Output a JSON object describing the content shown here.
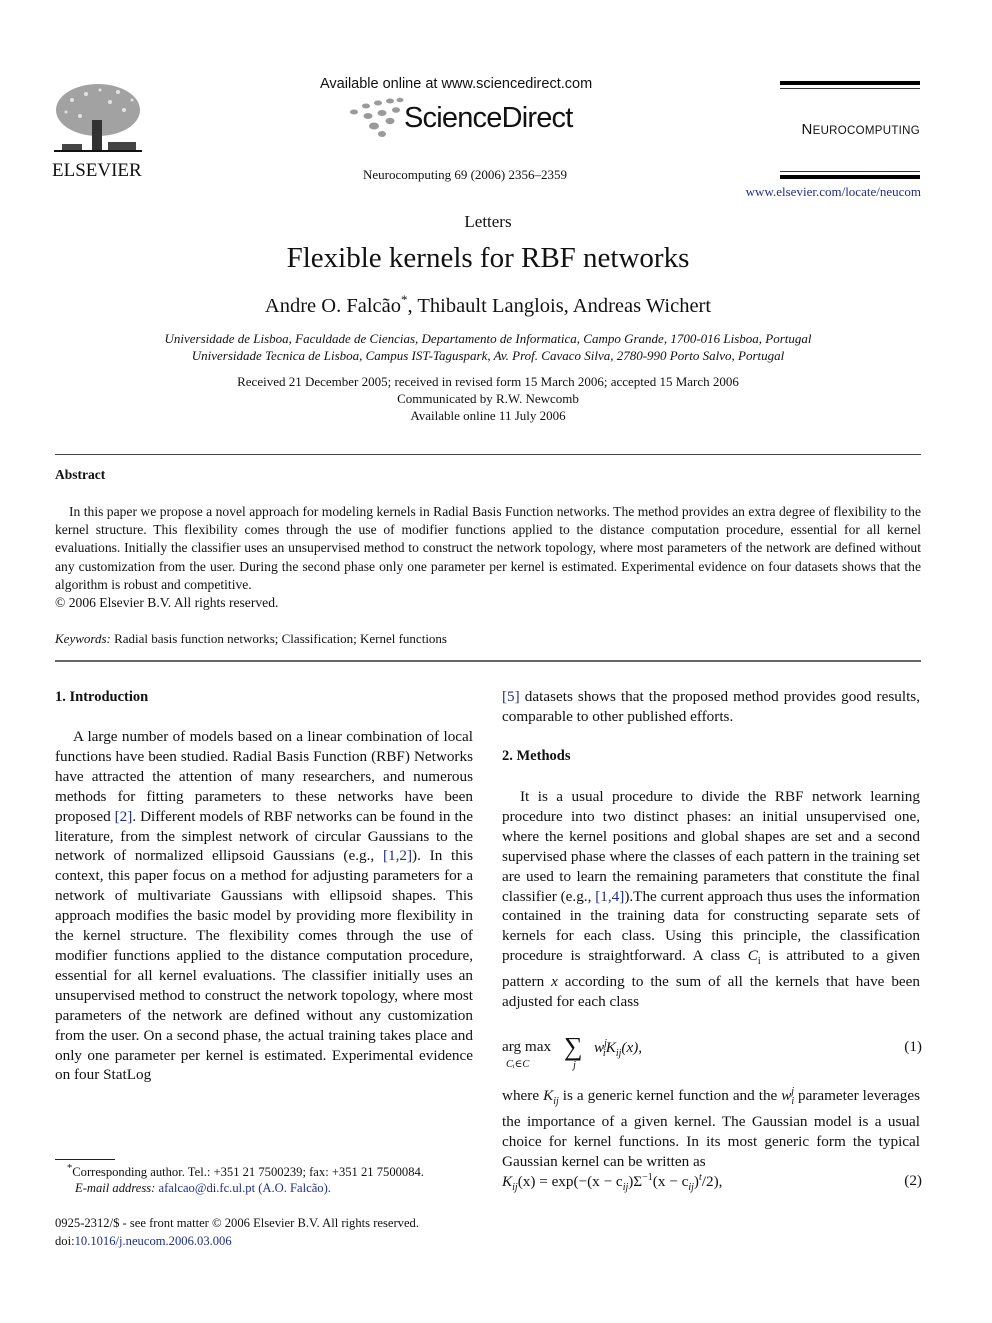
{
  "header": {
    "publisher": "ELSEVIER",
    "available_online": "Available online at www.sciencedirect.com",
    "sciencedirect_logo": "ScienceDirect",
    "journal_reference": "Neurocomputing 69 (2006) 2356–2359",
    "journal_name_first": "N",
    "journal_name_rest": "EUROCOMPUTING",
    "journal_url": "www.elsevier.com/locate/neucom"
  },
  "article": {
    "section_type": "Letters",
    "title": "Flexible kernels for RBF networks",
    "authors": {
      "author1": "Andre O. Falcão",
      "author1_mark": "*",
      "rest": ", Thibault Langlois, Andreas Wichert"
    },
    "affiliations": [
      "Universidade de Lisboa, Faculdade de Ciencias, Departamento de Informatica, Campo Grande, 1700-016 Lisboa, Portugal",
      "Universidade Tecnica de Lisboa, Campus IST-Taguspark, Av. Prof. Cavaco Silva, 2780-990 Porto Salvo, Portugal"
    ],
    "dates": {
      "received": "Received 21 December 2005; received in revised form 15 March 2006; accepted 15 March 2006",
      "communicated": "Communicated by R.W. Newcomb",
      "available": "Available online 11 July 2006"
    }
  },
  "abstract": {
    "heading": "Abstract",
    "body": "In this paper we propose a novel approach for modeling kernels in Radial Basis Function networks. The method provides an extra degree of flexibility to the kernel structure. This flexibility comes through the use of modifier functions applied to the distance computation procedure, essential for all kernel evaluations. Initially the classifier uses an unsupervised method to construct the network topology, where most parameters of the network are defined without any customization from the user. During the second phase only one parameter per kernel is estimated. Experimental evidence on four datasets shows that the algorithm is robust and competitive.",
    "copyright": "© 2006 Elsevier B.V. All rights reserved.",
    "keywords_label": "Keywords:",
    "keywords": "Radial basis function networks; Classification; Kernel functions"
  },
  "sections": {
    "intro": {
      "heading": "1.  Introduction",
      "p1": "A large number of models based on a linear combination of local functions have been studied. Radial Basis Function (RBF) Networks have attracted the attention of many researchers, and numerous methods for fitting parameters to these networks have been proposed ",
      "ref_a": "[2]",
      "p2": ". Different models of RBF networks can be found in the literature, from the simplest network of circular Gaussians to the network of normalized ellipsoid Gaussians (e.g., ",
      "ref_b": "[1,2]",
      "p3": "). In this context, this paper focus on a method for adjusting parameters for a network of multivariate Gaussians with ellipsoid shapes. This approach modifies the basic model by providing more flexibility in the kernel structure. The flexibility comes through the use of modifier functions applied to the distance computation procedure, essential for all kernel evaluations. The classifier initially uses an unsupervised method to construct the network topology, where most parameters of the network are defined without any customization from the user. On a second phase, the actual training takes place and only one parameter per kernel is estimated. Experimental evidence on four StatLog"
    },
    "col2_cont": {
      "ref": "[5]",
      "text": " datasets shows that the proposed method provides good results, comparable to other published efforts."
    },
    "methods": {
      "heading": "2.  Methods",
      "p1": "It is a usual procedure to divide the RBF network learning procedure into two distinct phases: an initial unsupervised one, where the kernel positions and global shapes are set and a second supervised phase where the classes of each pattern in the training set are used to learn the remaining parameters that constitute the final classifier (e.g., ",
      "ref": "[1,4]",
      "p2": ").The current approach thus uses the information contained in the training data for constructing separate sets of kernels for each class. Using this principle, the classification procedure is straightforward. A class ",
      "ci": "C",
      "ci_sub": "i",
      "p3": " is attributed to a given pattern ",
      "x": "x",
      "p4": " according to the sum of all the kernels that have been adjusted for each class",
      "eq1": {
        "argmax": "arg max",
        "argmax_sub": "Cᵢ∈C",
        "sigma": "∑",
        "sum_sub": "j",
        "w": "w",
        "w_sup": "j",
        "w_sub": "i",
        "k": "K",
        "k_sub": "ij",
        "tail": "(x),",
        "number": "(1)"
      },
      "p5_a": "where ",
      "kij": "K",
      "kij_sub": "ij",
      "p5_b": " is a generic kernel function and the ",
      "wij": "w",
      "wij_sub": "i",
      "wij_sup": "j",
      "p5_c": " parameter leverages the importance of a given kernel. The Gaussian model is a usual choice for kernel functions. In its most generic form the typical Gaussian kernel can be written as",
      "eq2": {
        "lhs": "K",
        "lhs_sub": "ij",
        "lhs_arg": "(x) = exp(−(x − c",
        "c_sub": "ij",
        "mid": ")Σ",
        "inv": "−1",
        "mid2": "(x − c",
        "c_sub2": "ij",
        "end": ")",
        "t": "t",
        "tail": "/2),",
        "number": "(2)"
      }
    }
  },
  "footnotes": {
    "author_mark": "*",
    "author": "Corresponding author. Tel.: +351 21 7500239; fax: +351 21 7500084.",
    "email_label": "E-mail address:",
    "email": "afalcao@di.fc.ul.pt (A.O. Falcão).",
    "front_matter": "0925-2312/$ - see front matter © 2006 Elsevier B.V. All rights reserved.",
    "doi_label": "doi:",
    "doi": "10.1016/j.neucom.2006.03.006"
  }
}
